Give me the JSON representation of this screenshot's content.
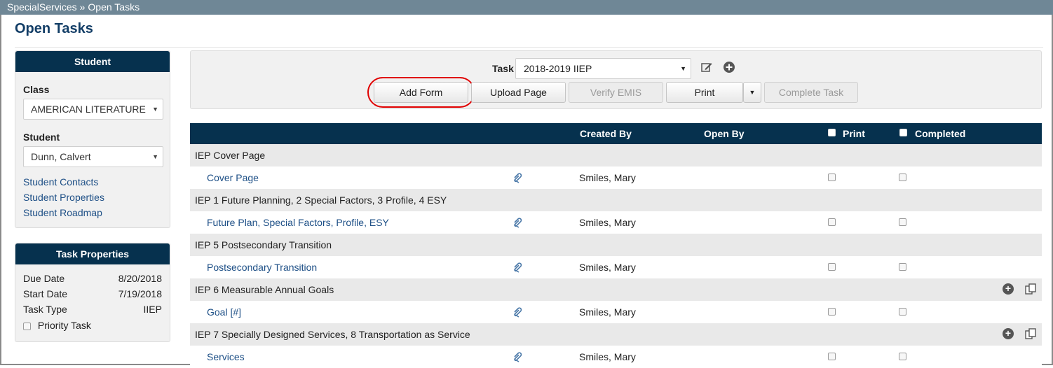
{
  "breadcrumb": {
    "root": "SpecialServices",
    "sep": "»",
    "current": "Open Tasks"
  },
  "page_title": "Open Tasks",
  "student_panel": {
    "title": "Student",
    "class_label": "Class",
    "class_value": "AMERICAN LITERATURE",
    "student_label": "Student",
    "student_value": "Dunn, Calvert",
    "links": [
      "Student Contacts",
      "Student Properties",
      "Student Roadmap"
    ]
  },
  "task_properties": {
    "title": "Task Properties",
    "rows": [
      {
        "label": "Due Date",
        "value": "8/20/2018"
      },
      {
        "label": "Start Date",
        "value": "7/19/2018"
      },
      {
        "label": "Task Type",
        "value": "IIEP"
      }
    ],
    "priority_label": "Priority Task"
  },
  "toolbar": {
    "task_label": "Task",
    "task_value": "2018-2019 IIEP",
    "edit_icon": "edit-icon",
    "add_icon": "plus-circle-icon",
    "buttons": {
      "add_form": "Add Form",
      "upload_page": "Upload Page",
      "verify_emis": "Verify EMIS",
      "print": "Print",
      "complete_task": "Complete Task"
    }
  },
  "table": {
    "headers": {
      "created_by": "Created By",
      "open_by": "Open By",
      "print": "Print",
      "completed": "Completed"
    },
    "groups": [
      {
        "title": "IEP Cover Page",
        "actions": false,
        "form": "Cover Page",
        "created_by": "Smiles, Mary"
      },
      {
        "title": "IEP 1 Future Planning, 2 Special Factors, 3 Profile, 4 ESY",
        "actions": false,
        "form": "Future Plan, Special Factors, Profile, ESY",
        "created_by": "Smiles, Mary"
      },
      {
        "title": "IEP 5 Postsecondary Transition",
        "actions": false,
        "form": "Postsecondary Transition",
        "created_by": "Smiles, Mary"
      },
      {
        "title": "IEP 6 Measurable Annual Goals",
        "actions": true,
        "form": "Goal [#]",
        "created_by": "Smiles, Mary"
      },
      {
        "title": "IEP 7 Specially Designed Services, 8 Transportation as Service",
        "actions": true,
        "form": "Services",
        "created_by": "Smiles, Mary"
      }
    ]
  },
  "colors": {
    "header_navy": "#06314e",
    "crumb_bar": "#6f8796",
    "link_blue": "#1d4f86",
    "highlight_red": "#e00000"
  }
}
